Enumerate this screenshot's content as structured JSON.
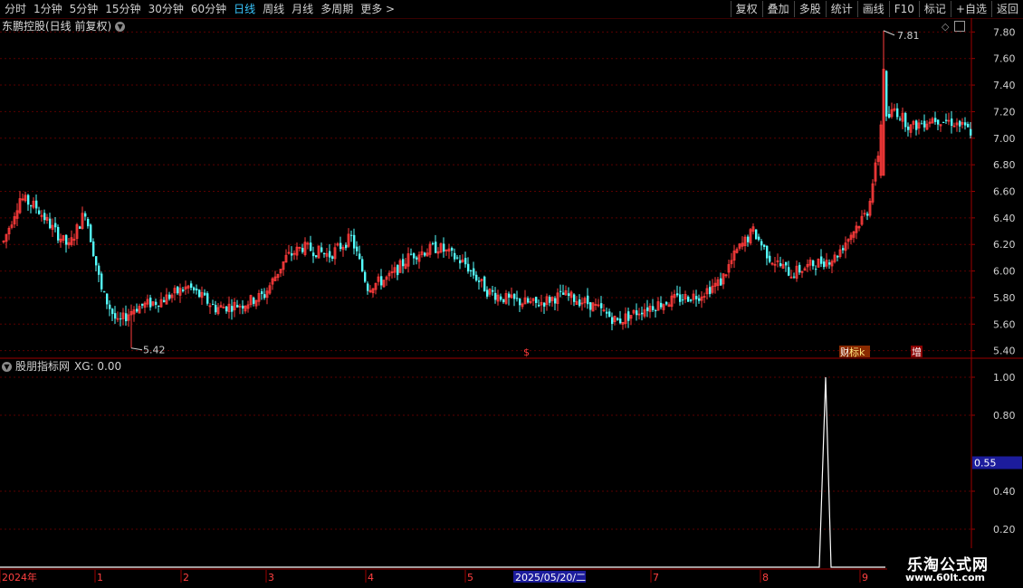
{
  "toolbar": {
    "periods": [
      "分时",
      "1分钟",
      "5分钟",
      "15分钟",
      "30分钟",
      "60分钟",
      "日线",
      "周线",
      "月线",
      "多周期",
      "更多 >"
    ],
    "active_period": "日线",
    "actions": [
      "复权",
      "叠加",
      "多股",
      "统计",
      "画线",
      "F10",
      "标记",
      "+自选",
      "返回"
    ]
  },
  "main_chart": {
    "title": "东鹏控股(日线 前复权)",
    "y_ticks": [
      "7.80",
      "7.60",
      "7.40",
      "7.20",
      "7.00",
      "6.80",
      "6.60",
      "6.40",
      "6.20",
      "6.00",
      "5.80",
      "5.60",
      "5.40"
    ],
    "high_label": "7.81",
    "low_label": "5.42",
    "event_markers": [
      "$",
      "财",
      "标k",
      "增"
    ]
  },
  "indicator": {
    "title": "股朋指标网",
    "value_text": "XG: 0.00",
    "y_ticks": [
      "1.00",
      "0.80",
      "0.40",
      "0.20"
    ],
    "current_value": "0.55"
  },
  "x_axis": {
    "labels": [
      "2024年",
      "1",
      "2",
      "3",
      "4",
      "5",
      "7",
      "8",
      "9"
    ],
    "cursor_date": "2025/05/20/二"
  },
  "watermark": {
    "line1": "乐淘公式网",
    "line2": "www.60lt.com"
  },
  "colors": {
    "up": "#ff3b3b",
    "down": "#54ffff",
    "grid": "#5a0000",
    "active": "#39c7ff"
  },
  "chart_data": {
    "type": "candlestick",
    "y_range": [
      5.35,
      7.85
    ],
    "high": 7.81,
    "low": 5.42,
    "indicator": {
      "name": "XG",
      "range": [
        0,
        1
      ],
      "spike_value": 1.0,
      "current": 0.55
    }
  }
}
